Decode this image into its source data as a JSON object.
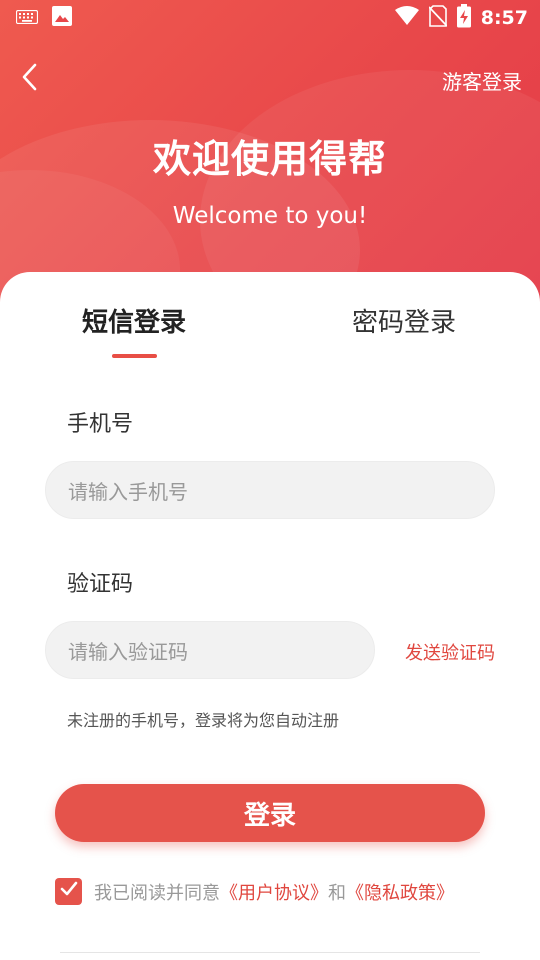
{
  "status_bar": {
    "time": "8:57",
    "left_icons": [
      "keyboard-icon",
      "image-icon"
    ],
    "right_icons": [
      "wifi-icon",
      "no-sim-icon",
      "battery-charging-icon"
    ]
  },
  "header": {
    "back_icon": "chevron-left-icon",
    "guest_login": "游客登录",
    "title": "欢迎使用得帮",
    "subtitle": "Welcome to you!"
  },
  "tabs": [
    {
      "label": "短信登录",
      "active": true
    },
    {
      "label": "密码登录",
      "active": false
    }
  ],
  "form": {
    "phone_label": "手机号",
    "phone_placeholder": "请输入手机号",
    "code_label": "验证码",
    "code_placeholder": "请输入验证码",
    "send_code": "发送验证码",
    "hint": "未注册的手机号，登录将为您自动注册",
    "login_button": "登录"
  },
  "agreement": {
    "checked": true,
    "prefix": "我已阅读并同意",
    "user_agreement": "《用户协议》",
    "and": "和",
    "privacy_policy": "《隐私政策》"
  },
  "colors": {
    "brand": "#e5534b",
    "header_gradient_start": "#ef5a4f",
    "header_gradient_end": "#e43a48",
    "link": "#e0473f"
  }
}
